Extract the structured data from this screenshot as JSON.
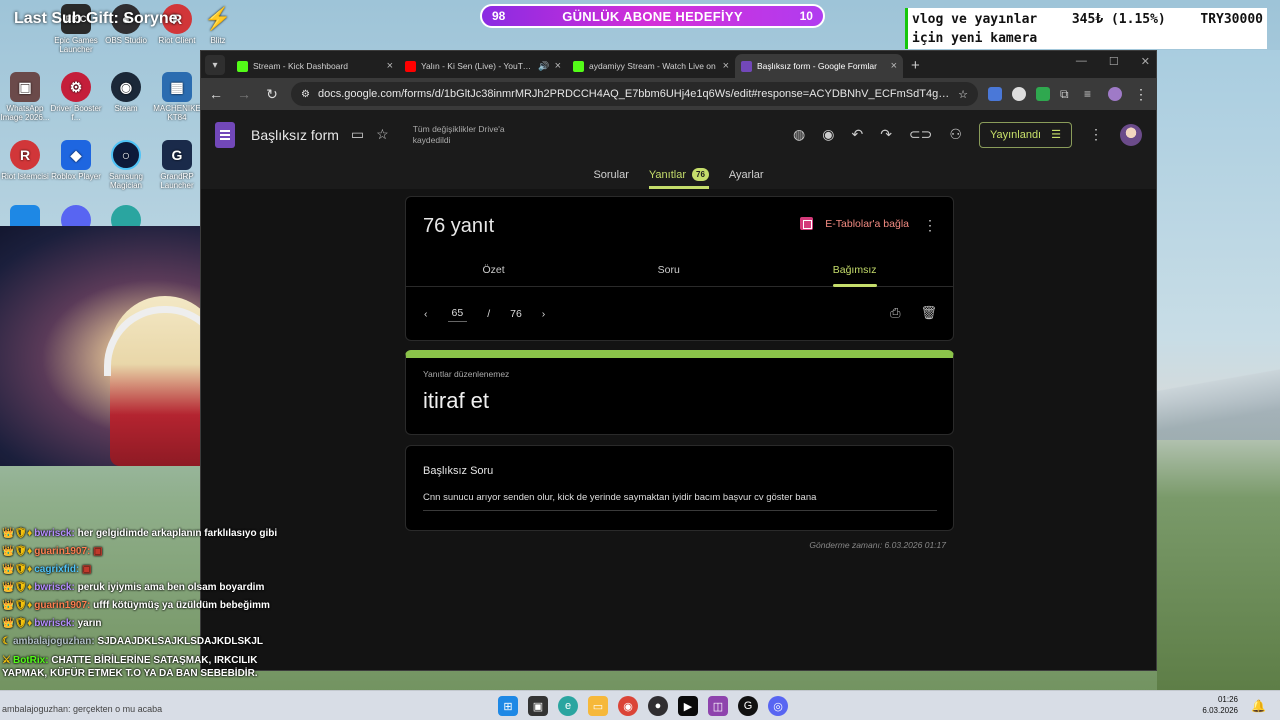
{
  "desktop": {
    "icons": [
      {
        "label": "Epic Games Launcher",
        "glyph": "EPIC",
        "color": "#2a2a2a"
      },
      {
        "label": "OBS Studio",
        "glyph": "●",
        "color": "#302e31"
      },
      {
        "label": "Riot Client",
        "glyph": "R",
        "color": "#d13639"
      },
      {
        "label": "Blitz",
        "glyph": "⚡",
        "color": "#e03a3a"
      },
      {
        "label": "WhatsApp Image 2026...",
        "glyph": "▣",
        "color": "#6b4a4a"
      },
      {
        "label": "Driver Booster f...",
        "glyph": "⚙",
        "color": "#c41e3a"
      },
      {
        "label": "Steam",
        "glyph": "◉",
        "color": "#1b2838"
      },
      {
        "label": "MACHENIKE KT84",
        "glyph": "▦",
        "color": "#2b6cb0"
      },
      {
        "label": "Riot Istemcisi",
        "glyph": "R",
        "color": "#d13639"
      },
      {
        "label": "Roblox Player",
        "glyph": "◆",
        "color": "#1e66e0"
      },
      {
        "label": "Samsung Magician",
        "glyph": "○",
        "color": "#0d1a3a"
      },
      {
        "label": "GrandRP Launcher",
        "glyph": "G",
        "color": "#1a2a4a"
      }
    ]
  },
  "overlay": {
    "gift_text": "Last Sub Gift: Soryne",
    "goal_left": "98",
    "goal_label": "GÜNLÜK ABONE HEDEFİYY",
    "goal_right": "10",
    "goalbox_line1": "vlog ve yayınlar",
    "goalbox_amount": "345₺ (1.15%)",
    "goalbox_target": "TRY30000",
    "goalbox_line2": "için yeni kamera"
  },
  "chat": [
    {
      "badges": "👑🛡♦",
      "user": "bwrisck:",
      "user_color": "#b48cff",
      "text": "her gelgidimde arkaplanın farklılasıyo gibi"
    },
    {
      "badges": "👑🛡♦",
      "user": "guarin1907:",
      "user_color": "#ff7f50",
      "text": "▣"
    },
    {
      "badges": "👑🛡♦",
      "user": "cagrixfid:",
      "user_color": "#4fc3f7",
      "text": "▣"
    },
    {
      "badges": "👑🛡♦",
      "user": "bwrisck:",
      "user_color": "#b48cff",
      "text": "peruk iyiymis ama ben olsam boyardim"
    },
    {
      "badges": "👑🛡♦",
      "user": "guarin1907:",
      "user_color": "#ff7f50",
      "text": "ufff kötüymüş ya üzüldüm bebeğimm"
    },
    {
      "badges": "👑🛡♦",
      "user": "bwrisck:",
      "user_color": "#b48cff",
      "text": "yarın"
    },
    {
      "badges": "☾",
      "user": "ambalajoguzhan:",
      "user_color": "#b0bec5",
      "text": "SJDAAJDKLSAJKLSDAJKDLSKJL"
    },
    {
      "badges": "⚔",
      "user": "BotRix:",
      "user_color": "#53fc18",
      "text": "CHATTE BİRİLERİNE SATAŞMAK, IRKCILIK YAPMAK, KÜFÜR ETMEK T.O YA DA BAN SEBEBİDİR."
    }
  ],
  "chat_footer": "ambalajoguzhan: gerçekten o mu acaba",
  "browser": {
    "tabs": [
      {
        "title": "Stream - Kick Dashboard",
        "fav": "#53fc18",
        "active": false
      },
      {
        "title": "Yalın - Ki Sen (Live) - YouTube",
        "fav": "#ff0000",
        "active": false
      },
      {
        "title": "aydamiyy Stream - Watch Live on",
        "fav": "#53fc18",
        "active": false
      },
      {
        "title": "Başlıksız form - Google Formlar",
        "fav": "#7248b9",
        "active": true
      }
    ],
    "url": "docs.google.com/forms/d/1bGltJc38inmrMRJh2PRDCCH4AQ_E7bbm6UHj4e1q6Ws/edit#response=ACYDBNhV_ECFmSdT4gHDgUpTCK1..."
  },
  "form": {
    "title": "Başlıksız form",
    "saved_status": "Tüm değişiklikler Drive'a kaydedildi",
    "publish_label": "Yayınlandı",
    "tabs": {
      "questions": "Sorular",
      "responses": "Yanıtlar",
      "responses_count": "76",
      "settings": "Ayarlar"
    },
    "response_count_label": "76 yanıt",
    "sheets_link": "E-Tablolar'a bağla",
    "sub_tabs": {
      "summary": "Özet",
      "question": "Soru",
      "individual": "Bağımsız"
    },
    "pager": {
      "current": "65",
      "sep": "/",
      "total": "76"
    },
    "note": "Yanıtlar düzenlenemez",
    "form_name": "itiraf et",
    "question_title": "Başlıksız Soru",
    "answer": "Cnn sunucu arıyor senden olur, kick de yerinde saymaktan iyidir bacım başvur cv göster bana",
    "submitted": "Gönderme zamanı: 6.03.2026 01:17"
  },
  "taskbar": {
    "time": "01:26",
    "date": "6.03.2026"
  }
}
